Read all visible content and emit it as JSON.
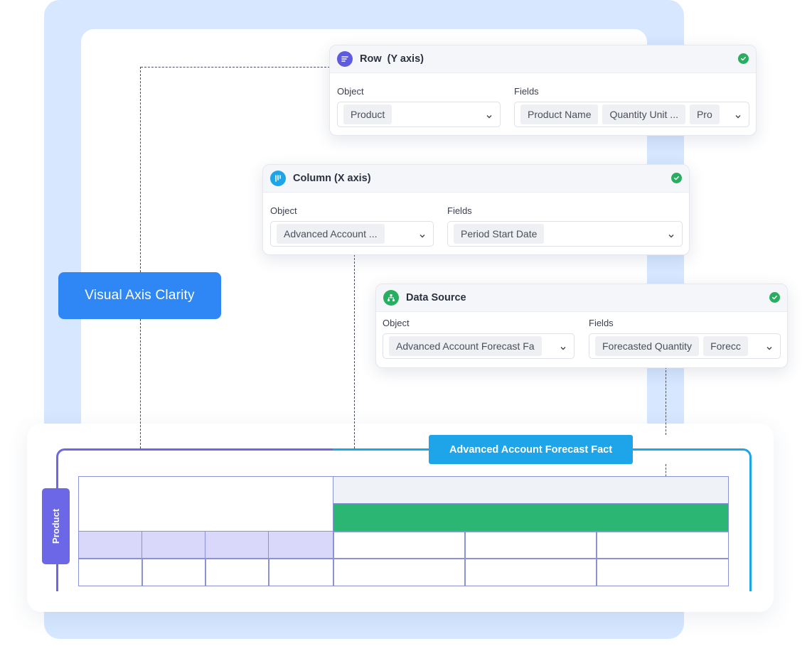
{
  "row_card": {
    "title": "Row  (Y axis)",
    "icon": "list-sort-icon",
    "object_label": "Object",
    "fields_label": "Fields",
    "object_value": "Product",
    "fields_values": [
      "Product Name",
      "Quantity Unit ...",
      "Pro"
    ],
    "status": "check-icon"
  },
  "column_card": {
    "title": "Column (X axis)",
    "icon": "bar-columns-icon",
    "object_label": "Object",
    "fields_label": "Fields",
    "object_value": "Advanced Account ...",
    "fields_values": [
      "Period Start Date"
    ],
    "status": "check-icon"
  },
  "datasource_card": {
    "title": "Data Source",
    "icon": "hierarchy-icon",
    "object_label": "Object",
    "fields_label": "Fields",
    "object_value": "Advanced Account Forecast Fa",
    "fields_values": [
      "Forecasted Quantity",
      "Forecc"
    ],
    "status": "check-icon"
  },
  "feature_pill": {
    "label": "Visual Axis Clarity"
  },
  "diagram": {
    "fact_label": "Advanced Account Forecast Fact",
    "row_label": "Product"
  },
  "colors": {
    "accent_blue": "#2f86f5",
    "fact_blue": "#1ea4e8",
    "row_purple": "#6b67e6",
    "row_fill": "#d9d8fb",
    "data_green": "#2bb673",
    "header_gray": "#eff2f7",
    "background_blue": "#d6e7ff"
  }
}
